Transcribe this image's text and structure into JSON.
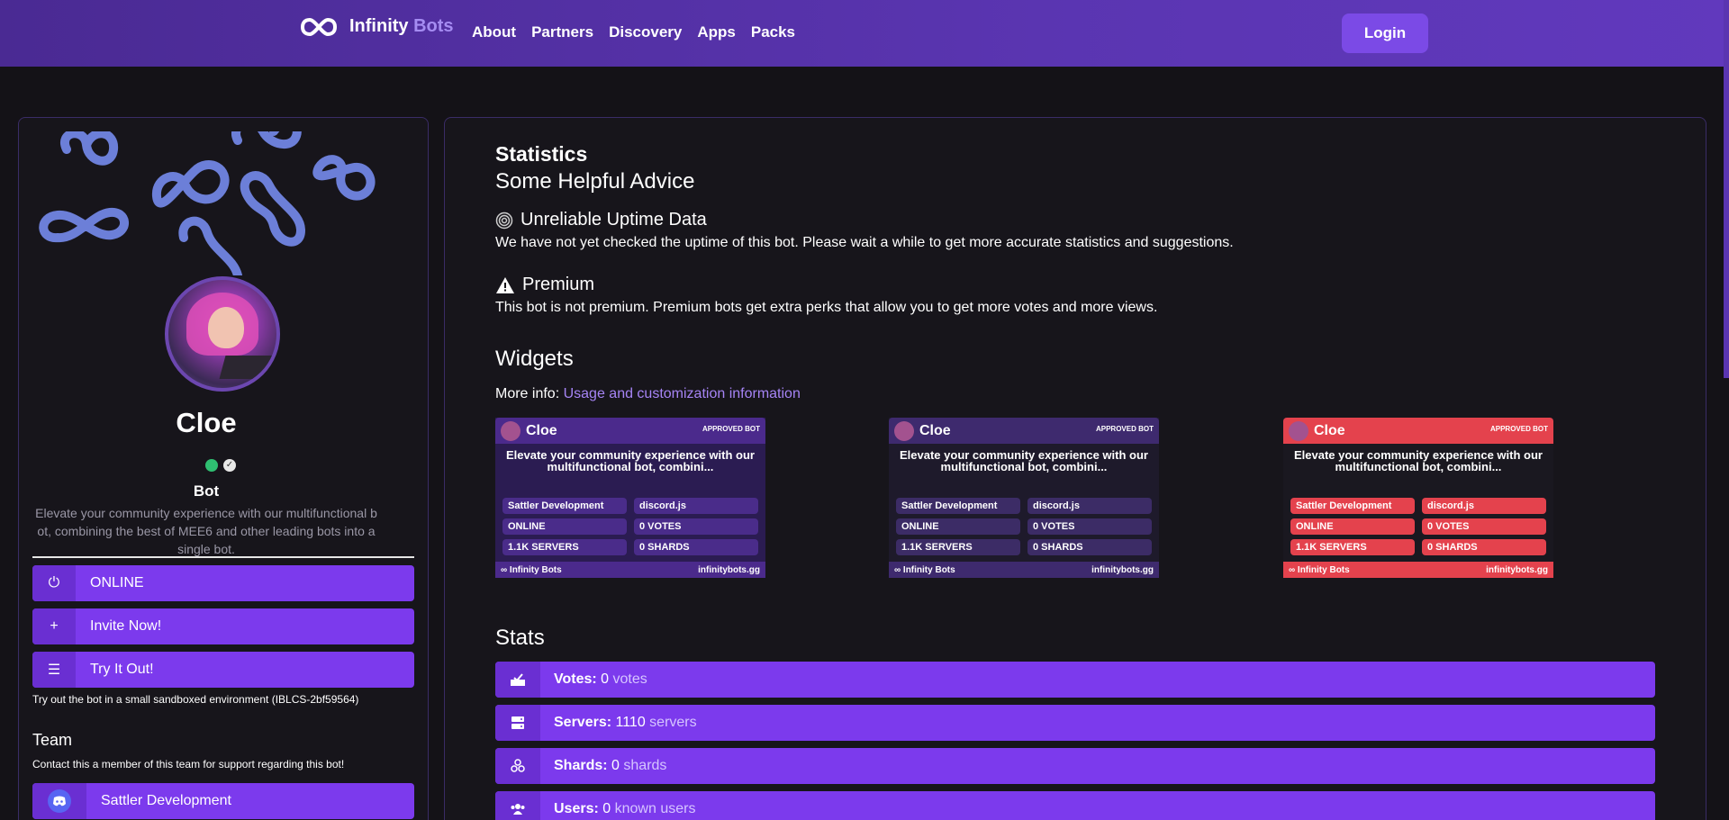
{
  "nav": {
    "brand_main": "Infinity",
    "brand_accent": "Bots",
    "links": [
      "About",
      "Partners",
      "Discovery",
      "Apps",
      "Packs"
    ],
    "login": "Login"
  },
  "bot": {
    "name": "Cloe",
    "type": "Bot",
    "description": "Elevate your community experience with our multifunctional bot, combining the best of MEE6 and other leading bots into a single bot.",
    "status_label": "ONLINE",
    "invite_label": "Invite Now!",
    "try_label": "Try It Out!",
    "sandbox_note": "Try out the bot in a small sandboxed environment (IBLCS-2bf59564)"
  },
  "team": {
    "title": "Team",
    "note": "Contact this a member of this team for support regarding this bot!",
    "members": [
      "Sattler Development"
    ]
  },
  "statistics": {
    "title": "Statistics",
    "subtitle": "Some Helpful Advice",
    "advice": [
      {
        "icon": "target-icon",
        "title": "Unreliable Uptime Data",
        "text": "We have not yet checked the uptime of this bot. Please wait a while to get more accurate statistics and suggestions."
      },
      {
        "icon": "warning-icon",
        "title": "Premium",
        "text": "This bot is not premium. Premium bots get extra perks that allow you to get more votes and more views."
      }
    ]
  },
  "widgets": {
    "title": "Widgets",
    "more_info_label": "More info:",
    "more_info_link": "Usage and customization information",
    "items": [
      {
        "name": "Cloe",
        "badge": "APPROVED BOT",
        "desc": "Elevate your community experience with our multifunctional bot, combini...",
        "pills": [
          "Sattler Development",
          "discord.js",
          "ONLINE",
          "0 VOTES",
          "1.1K SERVERS",
          "0 SHARDS"
        ],
        "foot_left": "Infinity Bots",
        "foot_right": "infinitybots.gg",
        "head_color": "#4b2a8c",
        "body_color": "#2b1c52",
        "pill_color": "#4a2c8a",
        "foot_color": "#4b2a8c"
      },
      {
        "name": "Cloe",
        "badge": "APPROVED BOT",
        "desc": "Elevate your community experience with our multifunctional bot, combini...",
        "pills": [
          "Sattler Development",
          "discord.js",
          "ONLINE",
          "0 VOTES",
          "1.1K SERVERS",
          "0 SHARDS"
        ],
        "foot_left": "Infinity Bots",
        "foot_right": "infinitybots.gg",
        "head_color": "#3e2a6e",
        "body_color": "#1e1a2b",
        "pill_color": "#3c2c66",
        "foot_color": "#3e2a6e"
      },
      {
        "name": "Cloe",
        "badge": "APPROVED BOT",
        "desc": "Elevate your community experience with our multifunctional bot, combini...",
        "pills": [
          "Sattler Development",
          "discord.js",
          "ONLINE",
          "0 VOTES",
          "1.1K SERVERS",
          "0 SHARDS"
        ],
        "foot_left": "Infinity Bots",
        "foot_right": "infinitybots.gg",
        "head_color": "#e4424d",
        "body_color": "#1a1820",
        "pill_color": "#e4424d",
        "foot_color": "#e4424d"
      }
    ]
  },
  "stats": {
    "title": "Stats",
    "items": [
      {
        "icon": "vote-box-icon",
        "label": "Votes:",
        "value": "0",
        "unit": "votes"
      },
      {
        "icon": "server-icon",
        "label": "Servers:",
        "value": "1110",
        "unit": "servers"
      },
      {
        "icon": "shards-icon",
        "label": "Shards:",
        "value": "0",
        "unit": "shards"
      },
      {
        "icon": "users-icon",
        "label": "Users:",
        "value": "0",
        "unit": "known users"
      }
    ]
  },
  "colors": {
    "accent": "#7c3aed",
    "accent_dark": "#6a2fd2",
    "nav": "#5a35b1",
    "link": "#a684f5",
    "banner_shape": "#6c7fd8"
  }
}
